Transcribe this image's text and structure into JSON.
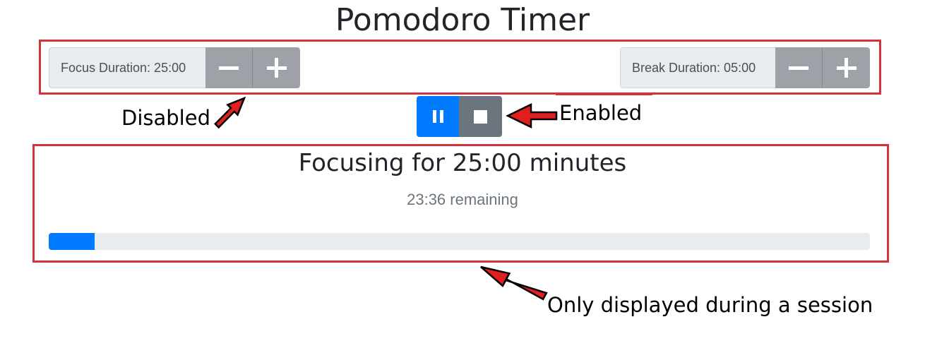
{
  "title": "Pomodoro Timer",
  "focus": {
    "label": "Focus Duration: 25:00",
    "disabled": true
  },
  "break": {
    "label": "Break Duration: 05:00",
    "disabled": true
  },
  "controls": {
    "enabled": true,
    "pause_icon": "pause-icon",
    "stop_icon": "stop-icon"
  },
  "session": {
    "heading": "Focusing for 25:00 minutes",
    "remaining": "23:36 remaining",
    "progress_fraction": 0.056
  },
  "annotations": {
    "disabled": "Disabled",
    "enabled": "Enabled",
    "session": "Only displayed during a session"
  },
  "colors": {
    "primary": "#007bff",
    "secondary": "#6c757d",
    "disabled_button": "#9ea2a8",
    "annotation_red": "#d3333d",
    "arrow_fill": "#e02020"
  }
}
